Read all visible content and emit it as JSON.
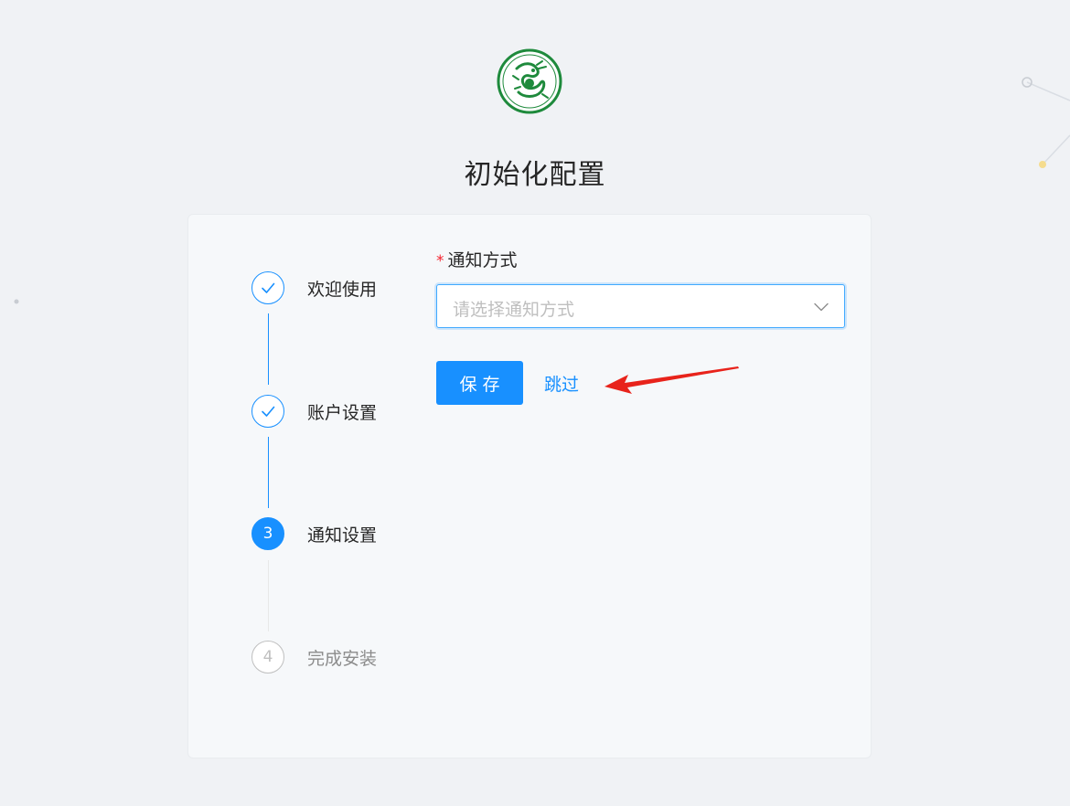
{
  "page": {
    "title": "初始化配置"
  },
  "steps": [
    {
      "label": "欢迎使用",
      "status": "finished",
      "icon": "check-icon"
    },
    {
      "label": "账户设置",
      "status": "finished",
      "icon": "check-icon"
    },
    {
      "label": "通知设置",
      "status": "active",
      "number": "3"
    },
    {
      "label": "完成安装",
      "status": "waiting",
      "number": "4"
    }
  ],
  "form": {
    "notify_method": {
      "label": "通知方式",
      "required": "*",
      "placeholder": "请选择通知方式",
      "value": ""
    }
  },
  "actions": {
    "save_label": "保存",
    "skip_label": "跳过"
  },
  "colors": {
    "primary": "#1890ff",
    "required": "#f5222d",
    "annotation_arrow": "#e8231b",
    "logo_green": "#1e8a3c"
  }
}
